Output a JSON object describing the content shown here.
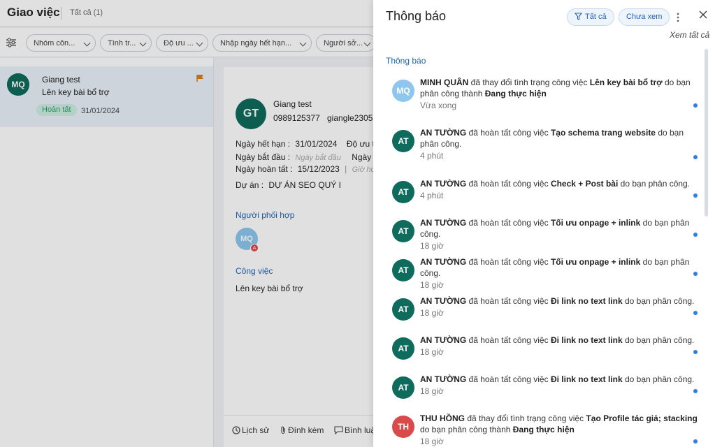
{
  "app": {
    "title": "Giao việc",
    "count_label": "Tất cả (1)"
  },
  "filters": [
    {
      "label": "Nhóm côn..."
    },
    {
      "label": "Tình tr..."
    },
    {
      "label": "Độ ưu ..."
    },
    {
      "label": "Nhập ngày hết hạn..."
    },
    {
      "label": "Người sở..."
    }
  ],
  "task": {
    "avatar": "GT",
    "name": "Giang test",
    "desc": "Lên key bài bổ trợ",
    "status": "Hoàn tất",
    "date": "31/01/2024",
    "assignee_avatar": "MQ"
  },
  "detail": {
    "avatar": "GT",
    "name": "Giang test",
    "phone": "0989125377",
    "email": "giangle2305",
    "deadline_label": "Ngày hết hạn :",
    "deadline_value": "31/01/2024",
    "priority_label": "Độ ưu t",
    "start_label": "Ngày bắt đầu :",
    "start_placeholder": "Ngày bắt đầu",
    "start_extra": "Ngày",
    "done_label": "Ngày hoàn tất :",
    "done_value": "15/12/2023",
    "done_sep": "|",
    "done_placeholder": "Giờ hoà",
    "project_label": "Dự án :",
    "project_value": "DỰ ÁN SEO QUÝ I",
    "collab_heading": "Người phối hợp",
    "collab_avatar": "MQ",
    "collab_badge": "A",
    "task_heading": "Công việc",
    "task_text": "Lên key bài bổ trợ",
    "footer": {
      "history": "Lịch sử",
      "attach": "Đính kèm",
      "comment": "Bình luậ"
    }
  },
  "panel": {
    "title": "Thông báo",
    "filter_all": "Tất cả",
    "filter_unread": "Chưa xem",
    "see_all": "Xem tất cả",
    "section": "Thông báo",
    "colors": {
      "accent": "#1e63b5",
      "unread_dot": "#2d7fe0",
      "teal_avatar": "#0f6b5c",
      "light_avatar": "#8ec6ee",
      "red_avatar": "#d94a4a"
    }
  },
  "notifications": [
    {
      "avatar": "MQ",
      "actor": "MINH QUÂN",
      "pre": " đã thay đổi tình trạng công việc ",
      "task": "Lên key bài bổ trợ",
      "post": " do bạn phân công thành ",
      "status": "Đang thực hiện",
      "time": "Vừa xong"
    },
    {
      "avatar": "AT",
      "actor": "AN TƯỜNG",
      "pre": " đã hoàn tất công việc ",
      "task": "Tạo schema trang website",
      "post": " do bạn phân công.",
      "status": "",
      "time": "4 phút"
    },
    {
      "avatar": "AT",
      "actor": "AN TƯỜNG",
      "pre": " đã hoàn tất công việc ",
      "task": "Check + Post bài",
      "post": " do bạn phân công.",
      "status": "",
      "time": "4 phút"
    },
    {
      "avatar": "AT",
      "actor": "AN TƯỜNG",
      "pre": " đã hoàn tất công việc ",
      "task": "Tối ưu onpage + inlink",
      "post": " do bạn phân công.",
      "status": "",
      "time": "18 giờ"
    },
    {
      "avatar": "AT",
      "actor": "AN TƯỜNG",
      "pre": " đã hoàn tất công việc ",
      "task": "Tối ưu onpage + inlink",
      "post": " do bạn phân công.",
      "status": "",
      "time": "18 giờ"
    },
    {
      "avatar": "AT",
      "actor": "AN TƯỜNG",
      "pre": " đã hoàn tất công việc ",
      "task": "Đi link no text link",
      "post": " do bạn phân công.",
      "status": "",
      "time": "18 giờ"
    },
    {
      "avatar": "AT",
      "actor": "AN TƯỜNG",
      "pre": " đã hoàn tất công việc ",
      "task": "Đi link no text link",
      "post": " do bạn phân công.",
      "status": "",
      "time": "18 giờ"
    },
    {
      "avatar": "AT",
      "actor": "AN TƯỜNG",
      "pre": " đã hoàn tất công việc ",
      "task": "Đi link no text link",
      "post": " do bạn phân công.",
      "status": "",
      "time": "18 giờ"
    },
    {
      "avatar": "TH",
      "actor": "THU HỒNG",
      "pre": " đã thay đổi tình trạng công việc ",
      "task": "Tạo Profile tác giả; stacking",
      "post": " do bạn phân công thành ",
      "status": "Đang thực hiện",
      "time": "18 giờ"
    }
  ]
}
